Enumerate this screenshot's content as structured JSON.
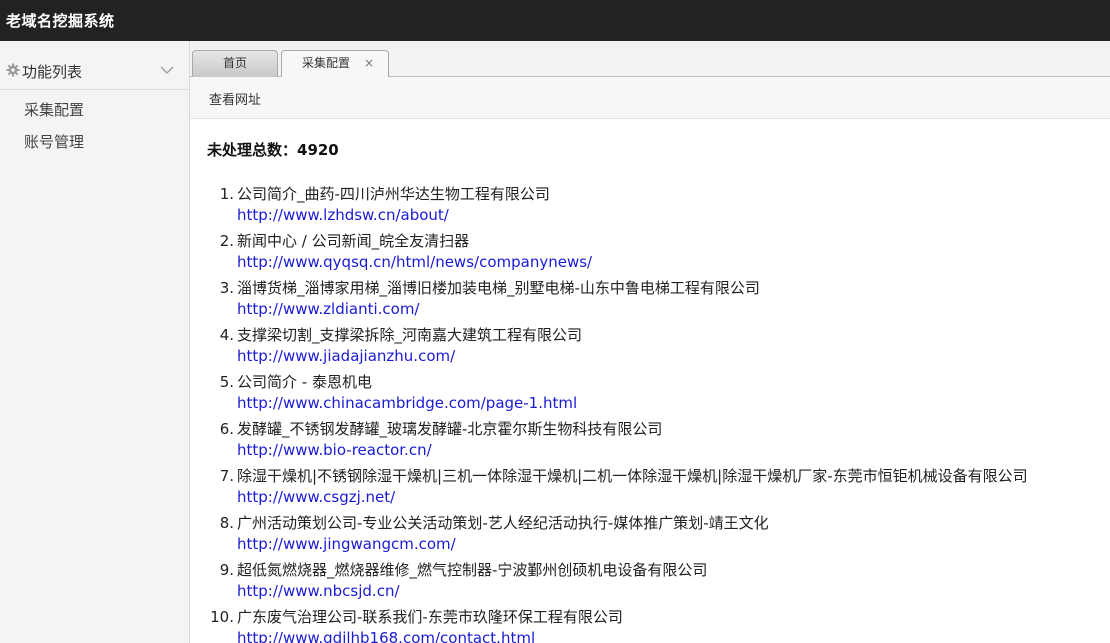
{
  "app": {
    "title": "老域名挖掘系统"
  },
  "sidebar": {
    "header": "功能列表",
    "gear_icon": "gear-icon",
    "items": [
      {
        "label": "采集配置"
      },
      {
        "label": "账号管理"
      }
    ]
  },
  "tabs": [
    {
      "label": "首页"
    },
    {
      "label": "采集配置",
      "close": "×"
    }
  ],
  "toolbar": {
    "view_urls": "查看网址"
  },
  "summary": {
    "text": "未处理总数：4920"
  },
  "entries": [
    {
      "num": "1.",
      "title": "公司简介_曲药-四川泸州华达生物工程有限公司",
      "url": "http://www.lzhdsw.cn/about/"
    },
    {
      "num": "2.",
      "title": "新闻中心 / 公司新闻_皖全友清扫器",
      "url": "http://www.qyqsq.cn/html/news/companynews/"
    },
    {
      "num": "3.",
      "title": "淄博货梯_淄博家用梯_淄博旧楼加装电梯_别墅电梯-山东中鲁电梯工程有限公司",
      "url": "http://www.zldianti.com/"
    },
    {
      "num": "4.",
      "title": "支撑梁切割_支撑梁拆除_河南嘉大建筑工程有限公司",
      "url": "http://www.jiadajianzhu.com/"
    },
    {
      "num": "5.",
      "title": "公司简介 - 泰恩机电",
      "url": "http://www.chinacambridge.com/page-1.html"
    },
    {
      "num": "6.",
      "title": "发酵罐_不锈钢发酵罐_玻璃发酵罐-北京霍尔斯生物科技有限公司",
      "url": "http://www.bio-reactor.cn/"
    },
    {
      "num": "7.",
      "title": "除湿干燥机|不锈钢除湿干燥机|三机一体除湿干燥机|二机一体除湿干燥机|除湿干燥机厂家-东莞市恒钜机械设备有限公司",
      "url": "http://www.csgzj.net/"
    },
    {
      "num": "8.",
      "title": "广州活动策划公司-专业公关活动策划-艺人经纪活动执行-媒体推广策划-靖王文化",
      "url": "http://www.jingwangcm.com/"
    },
    {
      "num": "9.",
      "title": "超低氮燃烧器_燃烧器维修_燃气控制器-宁波鄞州创硕机电设备有限公司",
      "url": "http://www.nbcsjd.cn/"
    },
    {
      "num": "10.",
      "title": "广东废气治理公司-联系我们-东莞市玖隆环保工程有限公司",
      "url": "http://www.gdjlhb168.com/contact.html"
    }
  ]
}
